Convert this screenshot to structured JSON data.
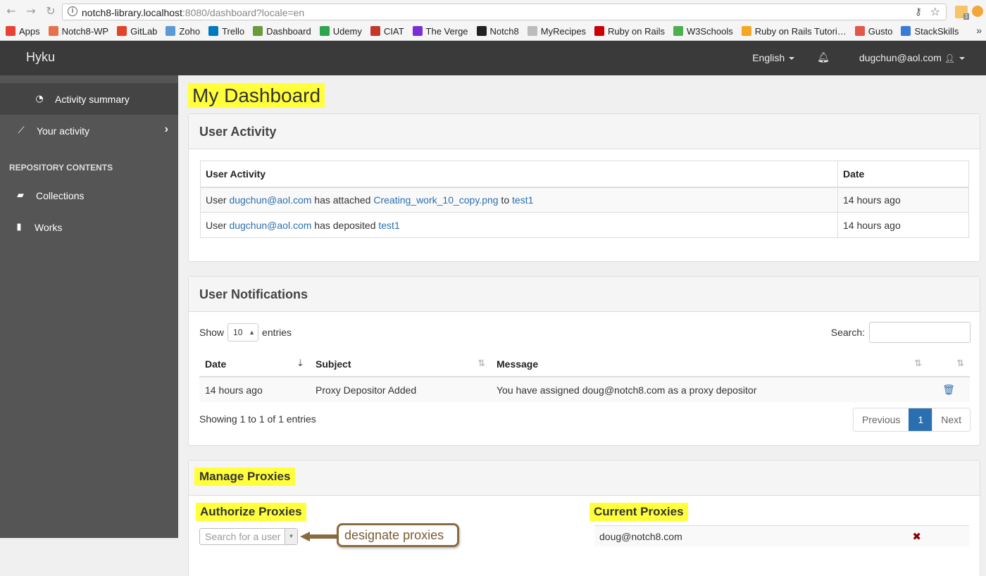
{
  "browser": {
    "url_host": "notch8-library.localhost",
    "url_rest": ":8080/dashboard?locale=en",
    "ext_badge": "3",
    "bookmarks": [
      {
        "label": "Apps",
        "icon": "apps-grid-icon",
        "color": "#e94235"
      },
      {
        "label": "Notch8-WP",
        "icon": "wordpress-icon",
        "color": "#e8714a"
      },
      {
        "label": "GitLab",
        "icon": "gitlab-icon",
        "color": "#e24329"
      },
      {
        "label": "Zoho",
        "icon": "zoho-icon",
        "color": "#5a9bd5"
      },
      {
        "label": "Trello",
        "icon": "trello-icon",
        "color": "#0079bf"
      },
      {
        "label": "Dashboard",
        "icon": "dashboard-icon",
        "color": "#6a9a3a"
      },
      {
        "label": "Udemy",
        "icon": "udemy-icon",
        "color": "#2ea44f"
      },
      {
        "label": "CIAT",
        "icon": "ciat-icon",
        "color": "#c0392b"
      },
      {
        "label": "The Verge",
        "icon": "verge-icon",
        "color": "#7b2ed6"
      },
      {
        "label": "Notch8",
        "icon": "github-icon",
        "color": "#222222"
      },
      {
        "label": "MyRecipes",
        "icon": "page-icon",
        "color": "#bbbbbb"
      },
      {
        "label": "Ruby on Rails",
        "icon": "rails-icon",
        "color": "#cc0000"
      },
      {
        "label": "W3Schools",
        "icon": "w3schools-icon",
        "color": "#4caf50"
      },
      {
        "label": "Ruby on Rails Tutori…",
        "icon": "tutorial-icon",
        "color": "#f5a623"
      },
      {
        "label": "Gusto",
        "icon": "gusto-icon",
        "color": "#e2574c"
      },
      {
        "label": "StackSkills",
        "icon": "stackskills-icon",
        "color": "#3a7bd5"
      }
    ],
    "more": "»"
  },
  "navbar": {
    "brand": "Hyku",
    "language": "English",
    "user": "dugchun@aol.com"
  },
  "sidebar": {
    "items": [
      {
        "label": "Activity summary",
        "icon": "dashboard-gauge-icon"
      },
      {
        "label": "Your activity",
        "icon": "line-chart-icon"
      },
      {
        "label": "Collections",
        "icon": "folder-open-icon"
      },
      {
        "label": "Works",
        "icon": "file-icon"
      }
    ],
    "section_heading": "REPOSITORY CONTENTS"
  },
  "main": {
    "title": "My Dashboard",
    "activity": {
      "title": "User Activity",
      "headers": [
        "User Activity",
        "Date"
      ],
      "rows": [
        {
          "pre": "User ",
          "user": "dugchun@aol.com",
          "mid": " has attached ",
          "file": "Creating_work_10_copy.png",
          "to": " to ",
          "work": "test1",
          "date": "14 hours ago"
        },
        {
          "pre": "User ",
          "user": "dugchun@aol.com",
          "mid": " has deposited ",
          "work": "test1",
          "date": "14 hours ago"
        }
      ]
    },
    "notifications": {
      "title": "User Notifications",
      "show_label": "Show",
      "entries_value": "10",
      "entries_label": "entries",
      "search_label": "Search:",
      "headers": [
        "Date",
        "Subject",
        "Message"
      ],
      "rows": [
        {
          "date": "14 hours ago",
          "subject": "Proxy Depositor Added",
          "message": "You have assigned doug@notch8.com as a proxy depositor"
        }
      ],
      "info": "Showing 1 to 1 of 1 entries",
      "pager": {
        "prev": "Previous",
        "page": "1",
        "next": "Next"
      }
    },
    "proxies": {
      "title": "Manage Proxies",
      "authorize_title": "Authorize Proxies",
      "search_placeholder": "Search for a user",
      "callout": "designate proxies",
      "current_title": "Current Proxies",
      "current": [
        "doug@notch8.com"
      ]
    }
  },
  "colors": {
    "highlight": "#ffff3c",
    "link": "#2a6fb0",
    "navbar": "#3a3a3a",
    "sidebar": "#555555"
  }
}
